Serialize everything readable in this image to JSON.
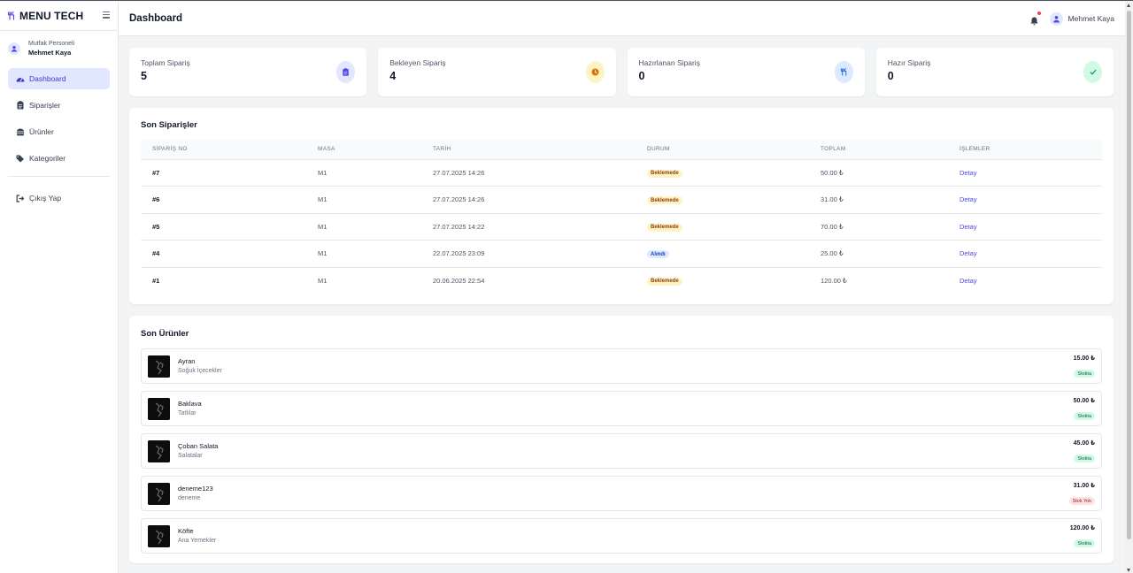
{
  "brand": {
    "title": "MENU TECH",
    "icon": "utensils-icon"
  },
  "user": {
    "role": "Mutfak Personeli",
    "name": "Mehmet Kaya"
  },
  "nav": {
    "items": [
      {
        "label": "Dashboard",
        "icon": "gauge-icon",
        "active": true
      },
      {
        "label": "Siparişler",
        "icon": "clipboard-icon",
        "active": false
      },
      {
        "label": "Ürünler",
        "icon": "burger-icon",
        "active": false
      },
      {
        "label": "Kategoriler",
        "icon": "tags-icon",
        "active": false
      }
    ],
    "logout": {
      "label": "Çıkış Yap",
      "icon": "sign-out-icon"
    }
  },
  "header": {
    "title": "Dashboard",
    "user_name": "Mehmet Kaya"
  },
  "stats": [
    {
      "label": "Toplam Sipariş",
      "value": "5",
      "icon": "clipboard-icon",
      "bg": "#e0e7ff",
      "fg": "#4f46e5"
    },
    {
      "label": "Bekleyen Sipariş",
      "value": "4",
      "icon": "clock-icon",
      "bg": "#fef3c7",
      "fg": "#d97706"
    },
    {
      "label": "Hazırlanan Sipariş",
      "value": "0",
      "icon": "utensils-icon",
      "bg": "#dbeafe",
      "fg": "#2563eb"
    },
    {
      "label": "Hazır Sipariş",
      "value": "0",
      "icon": "check-icon",
      "bg": "#d1fae5",
      "fg": "#059669"
    }
  ],
  "orders": {
    "title": "Son Siparişler",
    "columns": [
      "SİPARİŞ NO",
      "MASA",
      "TARİH",
      "DURUM",
      "TOPLAM",
      "İŞLEMLER"
    ],
    "rows": [
      {
        "no": "#7",
        "table": "M1",
        "date": "27.07.2025 14:26",
        "status": "Beklemede",
        "status_type": "pending",
        "total": "50.00 ₺",
        "action": "Detay"
      },
      {
        "no": "#6",
        "table": "M1",
        "date": "27.07.2025 14:26",
        "status": "Beklemede",
        "status_type": "pending",
        "total": "31.00 ₺",
        "action": "Detay"
      },
      {
        "no": "#5",
        "table": "M1",
        "date": "27.07.2025 14:22",
        "status": "Beklemede",
        "status_type": "pending",
        "total": "70.00 ₺",
        "action": "Detay"
      },
      {
        "no": "#4",
        "table": "M1",
        "date": "22.07.2025 23:09",
        "status": "Alındı",
        "status_type": "received",
        "total": "25.00 ₺",
        "action": "Detay"
      },
      {
        "no": "#1",
        "table": "M1",
        "date": "20.06.2025 22:54",
        "status": "Beklemede",
        "status_type": "pending",
        "total": "120.00 ₺",
        "action": "Detay"
      }
    ]
  },
  "products": {
    "title": "Son Ürünler",
    "items": [
      {
        "name": "Ayran",
        "category": "Soğuk İçecekler",
        "price": "15.00 ₺",
        "stock": "Stokta",
        "in_stock": true
      },
      {
        "name": "Baklava",
        "category": "Tatlılar",
        "price": "50.00 ₺",
        "stock": "Stokta",
        "in_stock": true
      },
      {
        "name": "Çoban Salata",
        "category": "Salatalar",
        "price": "45.00 ₺",
        "stock": "Stokta",
        "in_stock": true
      },
      {
        "name": "deneme123",
        "category": "deneme",
        "price": "31.00 ₺",
        "stock": "Stok Yok",
        "in_stock": false
      },
      {
        "name": "Köfte",
        "category": "Ana Yemekler",
        "price": "120.00 ₺",
        "stock": "Stokta",
        "in_stock": true
      }
    ]
  },
  "colors": {
    "accent": "#4f46e5",
    "active_bg": "#e0e7ff"
  }
}
